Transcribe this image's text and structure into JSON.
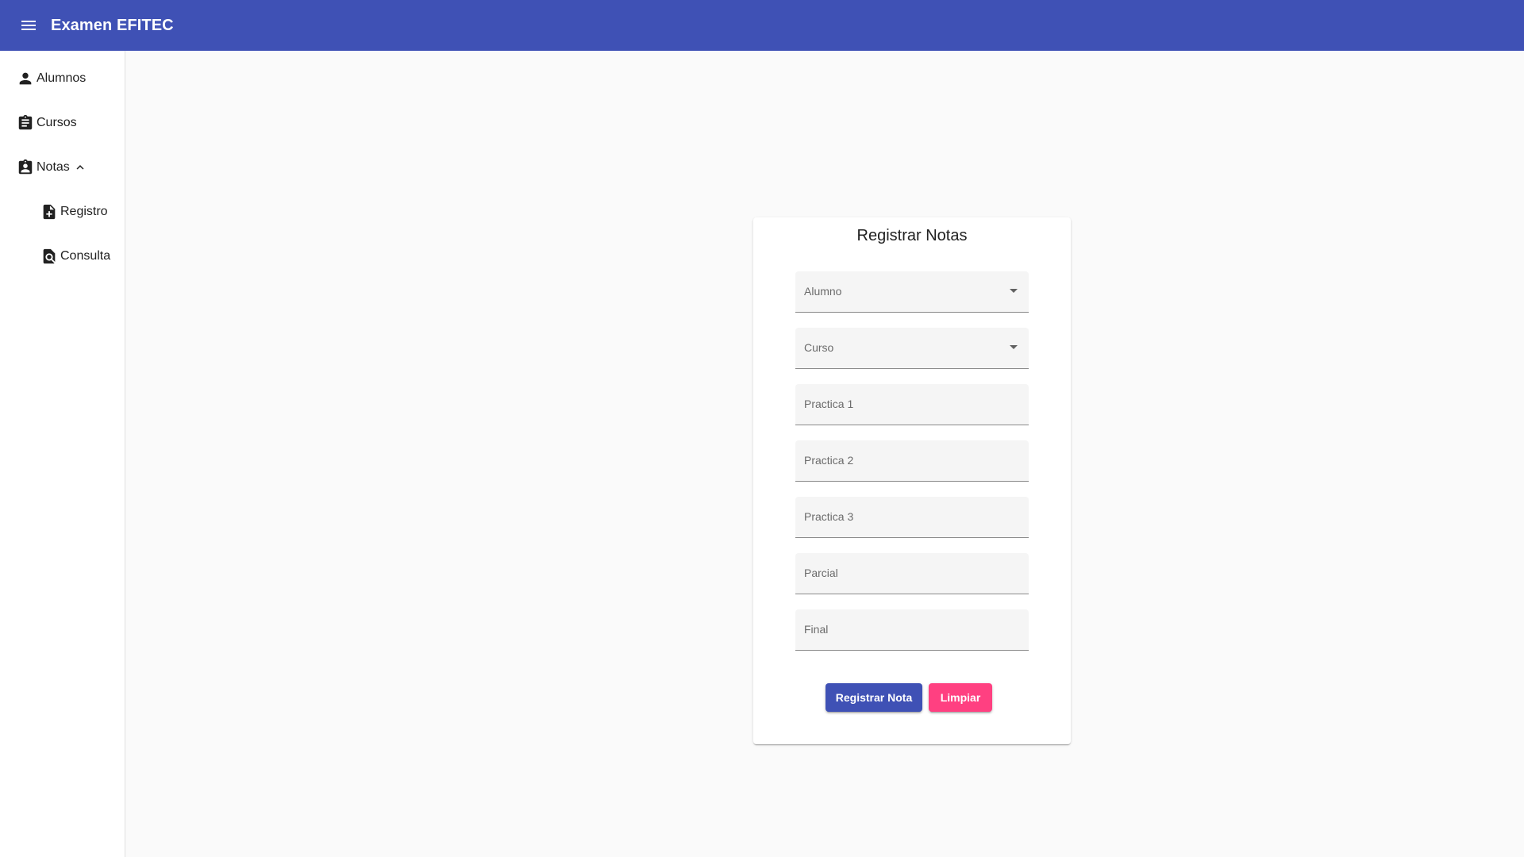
{
  "app": {
    "title": "Examen EFITEC"
  },
  "sidebar": {
    "items": [
      {
        "label": "Alumnos",
        "icon": "person-icon"
      },
      {
        "label": "Cursos",
        "icon": "assignment-icon"
      },
      {
        "label": "Notas",
        "icon": "assignment-ind-icon",
        "expanded": true
      },
      {
        "label": "Registro",
        "icon": "note-add-icon"
      },
      {
        "label": "Consulta",
        "icon": "find-in-page-icon"
      }
    ]
  },
  "form": {
    "title": "Registrar Notas",
    "fields": {
      "alumno": "Alumno",
      "curso": "Curso",
      "practica1": "Practica 1",
      "practica2": "Practica 2",
      "practica3": "Practica 3",
      "parcial": "Parcial",
      "final": "Final"
    },
    "submit_label": "Registrar Nota",
    "clear_label": "Limpiar"
  },
  "colors": {
    "primary": "#3f51b5",
    "accent": "#ff4081",
    "background": "#fafafa"
  }
}
